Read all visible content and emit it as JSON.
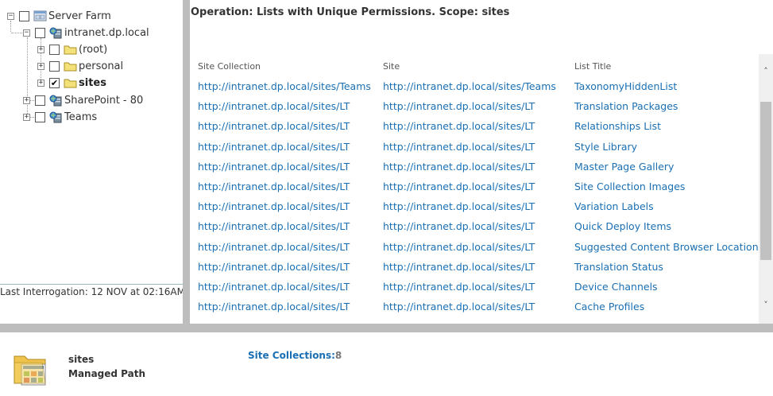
{
  "tree": {
    "nodes": [
      {
        "label": "Server Farm",
        "expander": "−",
        "checked": false
      },
      {
        "label": "intranet.dp.local",
        "expander": "−",
        "checked": false
      },
      {
        "label": "(root)",
        "expander": "+",
        "checked": false
      },
      {
        "label": "personal",
        "expander": "+",
        "checked": false
      },
      {
        "label": "sites",
        "expander": "+",
        "checked": true
      },
      {
        "label": "SharePoint - 80",
        "expander": "+",
        "checked": false
      },
      {
        "label": "Teams",
        "expander": "+",
        "checked": false
      }
    ],
    "last_interrogation": "Last Interrogation: 12 NOV at 02:16AM"
  },
  "main": {
    "operation_title": "Operation: Lists with Unique Permissions. Scope: sites",
    "columns": [
      "Site Collection",
      "Site",
      "List Title"
    ],
    "rows": [
      [
        "http://intranet.dp.local/sites/Teams",
        "http://intranet.dp.local/sites/Teams",
        "TaxonomyHiddenList"
      ],
      [
        "http://intranet.dp.local/sites/LT",
        "http://intranet.dp.local/sites/LT",
        "Translation Packages"
      ],
      [
        "http://intranet.dp.local/sites/LT",
        "http://intranet.dp.local/sites/LT",
        "Relationships List"
      ],
      [
        "http://intranet.dp.local/sites/LT",
        "http://intranet.dp.local/sites/LT",
        "Style Library"
      ],
      [
        "http://intranet.dp.local/sites/LT",
        "http://intranet.dp.local/sites/LT",
        "Master Page Gallery"
      ],
      [
        "http://intranet.dp.local/sites/LT",
        "http://intranet.dp.local/sites/LT",
        "Site Collection Images"
      ],
      [
        "http://intranet.dp.local/sites/LT",
        "http://intranet.dp.local/sites/LT",
        "Variation Labels"
      ],
      [
        "http://intranet.dp.local/sites/LT",
        "http://intranet.dp.local/sites/LT",
        "Quick Deploy Items"
      ],
      [
        "http://intranet.dp.local/sites/LT",
        "http://intranet.dp.local/sites/LT",
        "Suggested Content Browser Locations"
      ],
      [
        "http://intranet.dp.local/sites/LT",
        "http://intranet.dp.local/sites/LT",
        "Translation Status"
      ],
      [
        "http://intranet.dp.local/sites/LT",
        "http://intranet.dp.local/sites/LT",
        "Device Channels"
      ],
      [
        "http://intranet.dp.local/sites/LT",
        "http://intranet.dp.local/sites/LT",
        "Cache Profiles"
      ]
    ],
    "scroll_up_icon": "chevron-up-icon",
    "scroll_down_icon": "chevron-down-icon"
  },
  "details": {
    "name": "sites",
    "type": "Managed Path",
    "site_collections_label": "Site Collections:",
    "site_collections_count": "8"
  },
  "colors": {
    "link": "#1a6fb3",
    "splitter": "#bdbdbd"
  }
}
